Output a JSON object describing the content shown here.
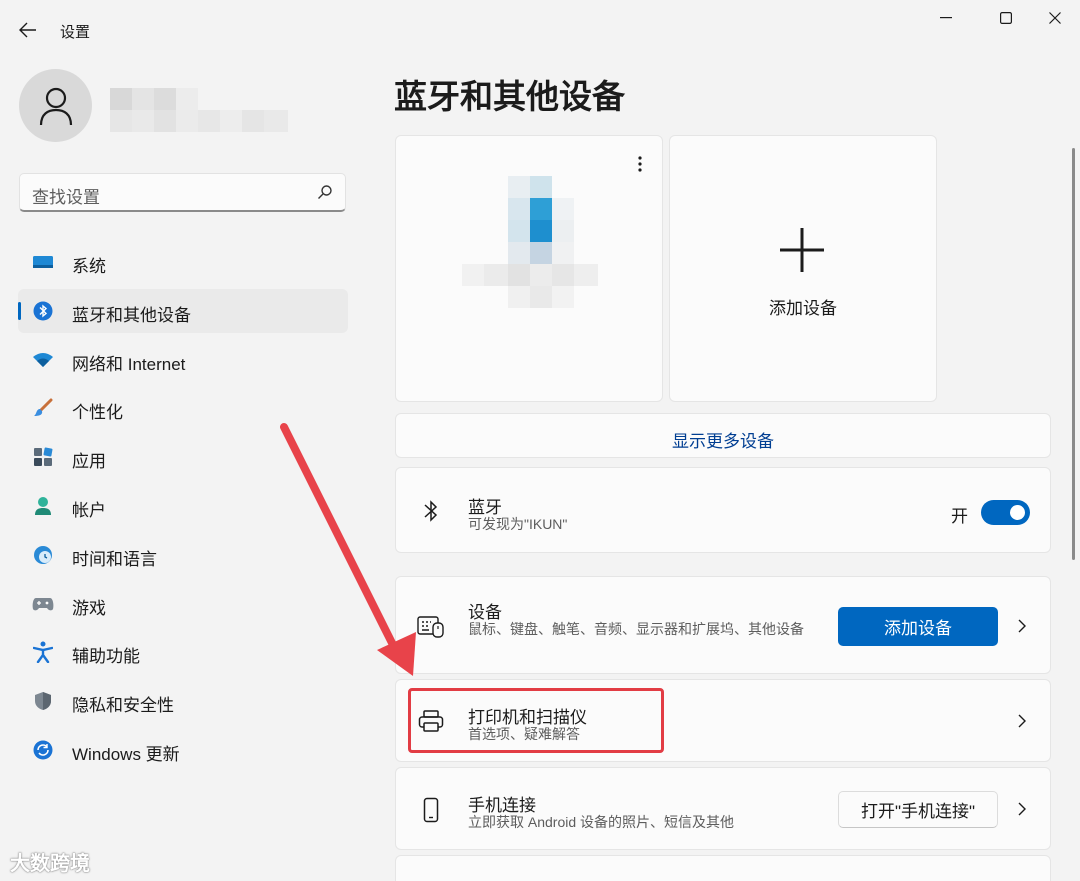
{
  "window": {
    "title": "设置"
  },
  "sidebar": {
    "search_placeholder": "查找设置",
    "items": [
      {
        "label": "系统",
        "icon": "display-icon"
      },
      {
        "label": "蓝牙和其他设备",
        "icon": "bluetooth-icon",
        "active": true
      },
      {
        "label": "网络和 Internet",
        "icon": "wifi-icon"
      },
      {
        "label": "个性化",
        "icon": "brush-icon"
      },
      {
        "label": "应用",
        "icon": "apps-icon"
      },
      {
        "label": "帐户",
        "icon": "account-icon"
      },
      {
        "label": "时间和语言",
        "icon": "globe-clock-icon"
      },
      {
        "label": "游戏",
        "icon": "gamepad-icon"
      },
      {
        "label": "辅助功能",
        "icon": "accessibility-icon"
      },
      {
        "label": "隐私和安全性",
        "icon": "shield-icon"
      },
      {
        "label": "Windows 更新",
        "icon": "update-icon"
      }
    ]
  },
  "main": {
    "title": "蓝牙和其他设备",
    "add_device_tile_label": "添加设备",
    "show_more_label": "显示更多设备",
    "bluetooth": {
      "title": "蓝牙",
      "subtitle": "可发现为\"IKUN\"",
      "toggle_label": "开",
      "enabled": true
    },
    "devices": {
      "title": "设备",
      "subtitle": "鼠标、键盘、触笔、音频、显示器和扩展坞、其他设备",
      "button_label": "添加设备"
    },
    "printers": {
      "title": "打印机和扫描仪",
      "subtitle": "首选项、疑难解答"
    },
    "phone": {
      "title": "手机连接",
      "subtitle": "立即获取 Android 设备的照片、短信及其他",
      "button_label": "打开\"手机连接\""
    }
  },
  "annotation": {
    "highlight_color": "#e23c44",
    "arrow_color": "#e23c44"
  },
  "watermark": {
    "text": "大数跨境"
  },
  "colors": {
    "accent": "#0067c0",
    "background": "#f3f3f3",
    "card": "#fbfbfb"
  }
}
